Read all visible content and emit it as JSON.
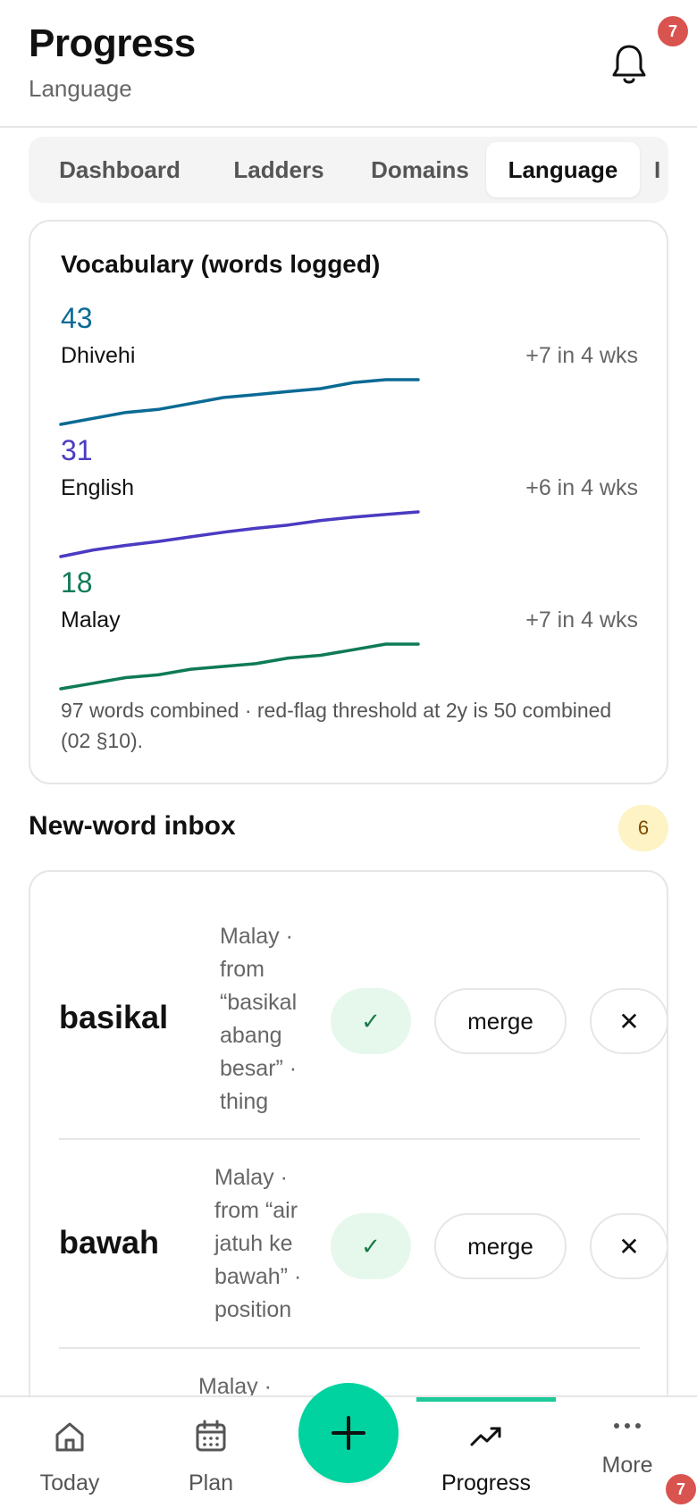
{
  "header": {
    "title": "Progress",
    "subtitle": "Language",
    "notification_count": "7"
  },
  "tabs": [
    {
      "label": "Dashboard",
      "active": false
    },
    {
      "label": "Ladders",
      "active": false
    },
    {
      "label": "Domains",
      "active": false
    },
    {
      "label": "Language",
      "active": true
    },
    {
      "label": "I",
      "active": false
    }
  ],
  "vocabulary": {
    "title": "Vocabulary (words logged)",
    "languages": [
      {
        "count": "43",
        "name": "Dhivehi",
        "delta": "+7 in 4 wks",
        "color": "#0a6a94"
      },
      {
        "count": "31",
        "name": "English",
        "delta": "+6 in 4 wks",
        "color": "#4a3bc2"
      },
      {
        "count": "18",
        "name": "Malay",
        "delta": "+7 in 4 wks",
        "color": "#0f7a56"
      }
    ],
    "footnote": "97 words combined · red-flag threshold at 2y is 50 combined (02 §10)."
  },
  "chart_data": {
    "type": "line",
    "title": "Vocabulary (words logged)",
    "series": [
      {
        "name": "Dhivehi",
        "values": [
          36,
          37,
          38,
          38.5,
          39.5,
          40.5,
          41,
          41.5,
          42,
          43,
          43.5,
          43.5
        ],
        "color": "#0a6a94"
      },
      {
        "name": "English",
        "values": [
          25,
          26,
          26.7,
          27.3,
          28,
          28.7,
          29.3,
          29.8,
          30.5,
          31,
          31.4,
          31.8
        ],
        "color": "#4a3bc2"
      },
      {
        "name": "Malay",
        "values": [
          11,
          12,
          13,
          13.5,
          14.5,
          15,
          15.5,
          16.5,
          17,
          18,
          19,
          19
        ],
        "color": "#0f7a56"
      }
    ]
  },
  "inbox": {
    "title": "New-word inbox",
    "count": "6",
    "items": [
      {
        "word": "basikal",
        "meta_lines": [
          "Malay ·",
          "from",
          "“basikal",
          "abang",
          "besar” ·",
          "thing"
        ]
      },
      {
        "word": "bawah",
        "meta_lines": [
          "Malay ·",
          "from “air",
          "jatuh ke",
          "bawah” ·",
          "position"
        ]
      },
      {
        "word": "",
        "meta_lines": [
          "Malay ·"
        ]
      }
    ],
    "accept_label": "✓",
    "merge_label": "merge",
    "reject_label": "✕"
  },
  "nav": {
    "items": [
      {
        "label": "Today",
        "icon": "home-icon",
        "active": false
      },
      {
        "label": "Plan",
        "icon": "calendar-icon",
        "active": false
      },
      {
        "label": "Progress",
        "icon": "trending-up-icon",
        "active": true
      },
      {
        "label": "More",
        "icon": "more-icon",
        "active": false
      }
    ],
    "more_badge": "7"
  }
}
